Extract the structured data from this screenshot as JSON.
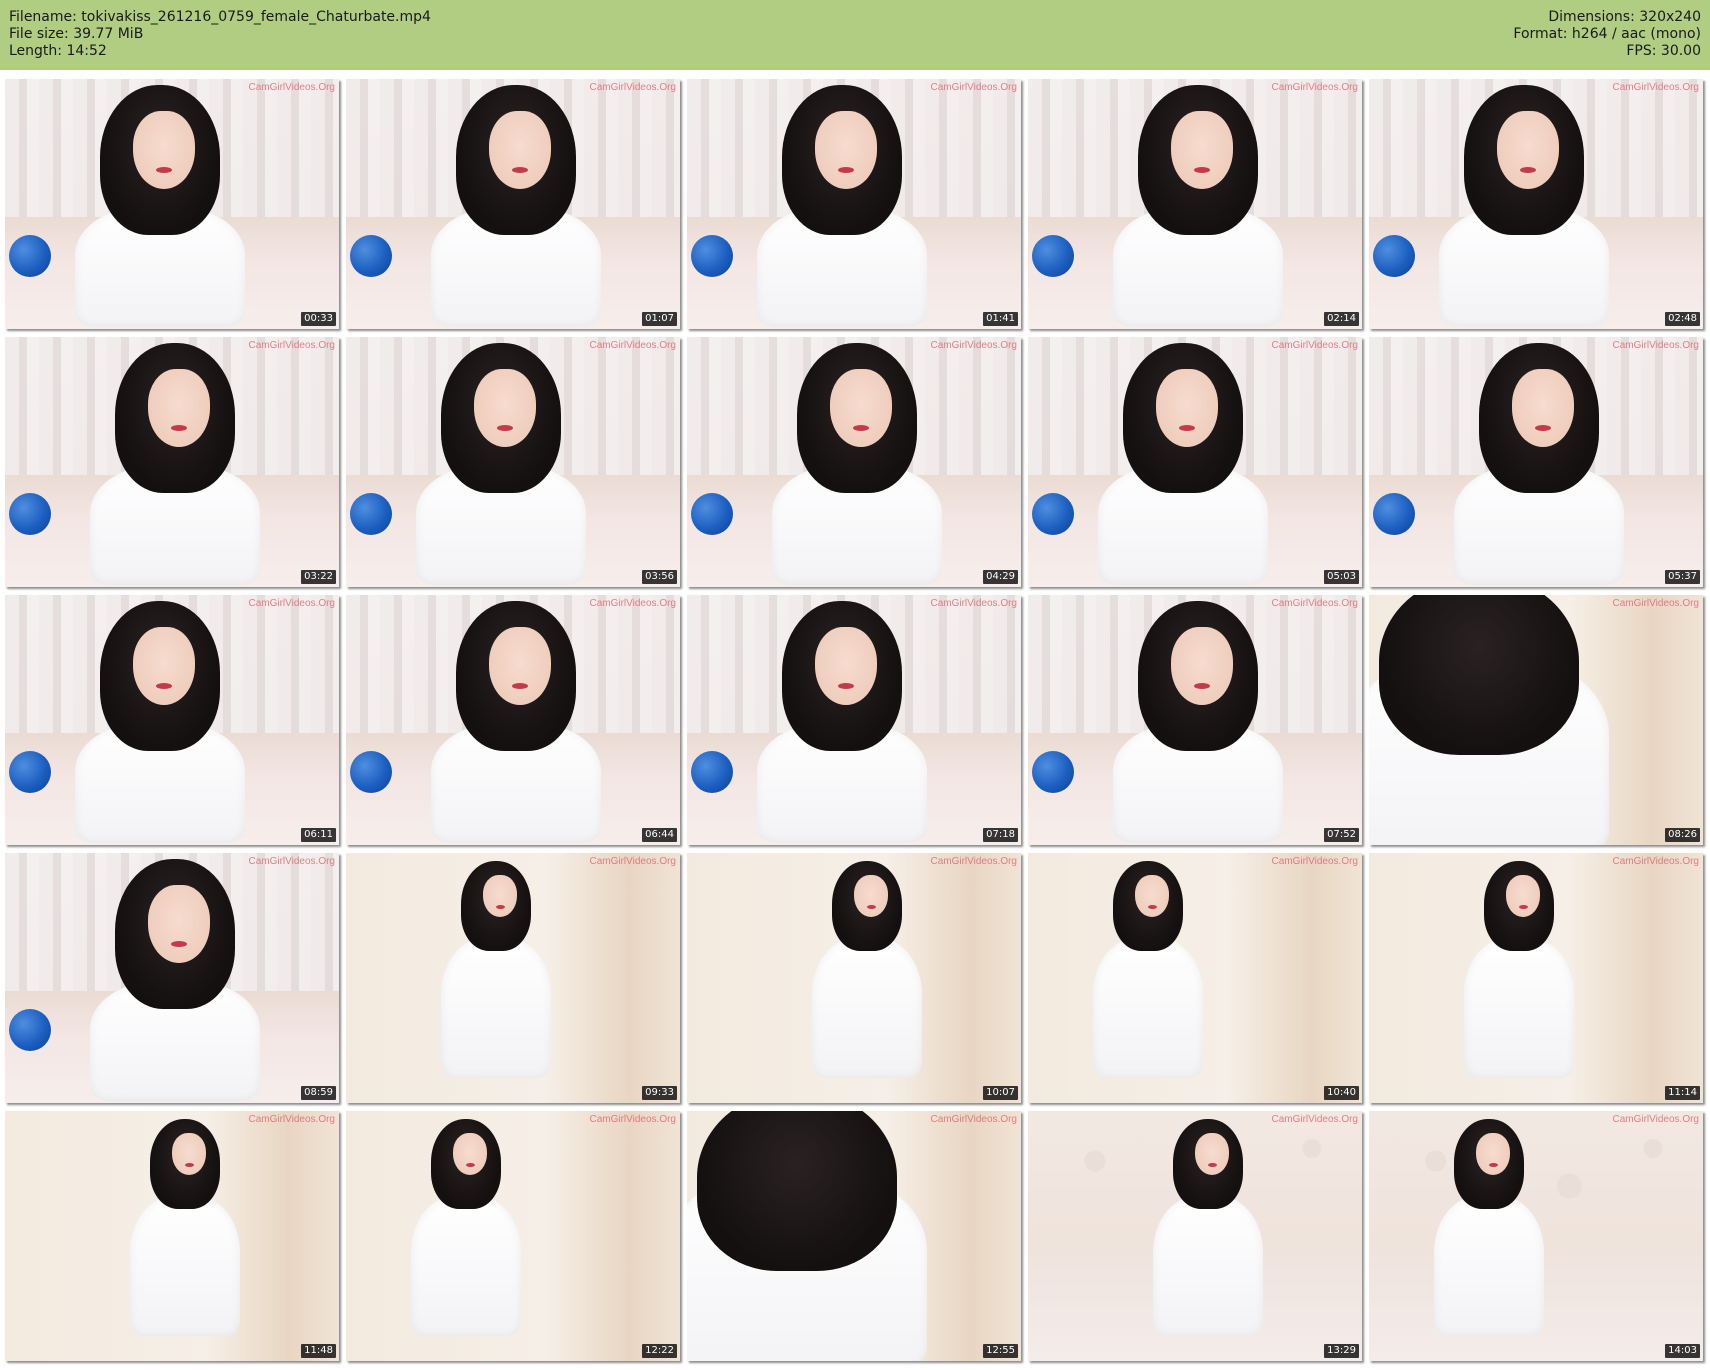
{
  "header": {
    "filename": "Filename: tokivakiss_261216_0759_female_Chaturbate.mp4",
    "filesize": "File size: 39.77 MiB",
    "length": "Length: 14:52",
    "dimensions": "Dimensions: 320x240",
    "format": "Format: h264 / aac (mono)",
    "fps": "FPS: 30.00",
    "background_color": "#b0cd82"
  },
  "watermark": "CamGirlVideos.Org",
  "thumbnails": [
    {
      "time": "00:33",
      "scene": "room"
    },
    {
      "time": "01:07",
      "scene": "room"
    },
    {
      "time": "01:41",
      "scene": "room"
    },
    {
      "time": "02:14",
      "scene": "room"
    },
    {
      "time": "02:48",
      "scene": "room"
    },
    {
      "time": "03:22",
      "scene": "room"
    },
    {
      "time": "03:56",
      "scene": "room"
    },
    {
      "time": "04:29",
      "scene": "room"
    },
    {
      "time": "05:03",
      "scene": "room"
    },
    {
      "time": "05:37",
      "scene": "room"
    },
    {
      "time": "06:11",
      "scene": "room"
    },
    {
      "time": "06:44",
      "scene": "room"
    },
    {
      "time": "07:18",
      "scene": "room"
    },
    {
      "time": "07:52",
      "scene": "room"
    },
    {
      "time": "08:26",
      "scene": "closeup"
    },
    {
      "time": "08:59",
      "scene": "room"
    },
    {
      "time": "09:33",
      "scene": "plain"
    },
    {
      "time": "10:07",
      "scene": "plain"
    },
    {
      "time": "10:40",
      "scene": "plain"
    },
    {
      "time": "11:14",
      "scene": "plain"
    },
    {
      "time": "11:48",
      "scene": "plain"
    },
    {
      "time": "12:22",
      "scene": "plain"
    },
    {
      "time": "12:55",
      "scene": "closeup"
    },
    {
      "time": "13:29",
      "scene": "floral"
    },
    {
      "time": "14:03",
      "scene": "floral"
    }
  ]
}
